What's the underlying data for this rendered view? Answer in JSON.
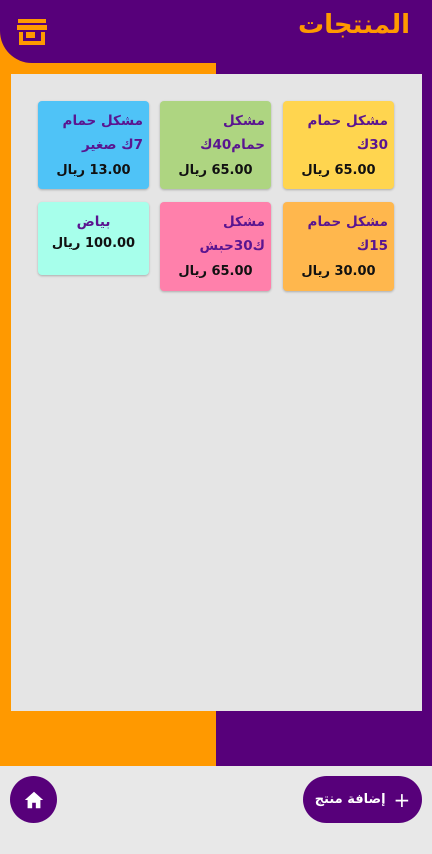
{
  "header": {
    "title": "المنتجات",
    "store_icon": "store-icon"
  },
  "colors": {
    "purple": "#57007a",
    "orange": "#ff9900",
    "panel": "#e5e5e5"
  },
  "products": [
    {
      "name": "مشكل حمام 30ك",
      "price": "65.00 ريال",
      "color": "#ffd54f"
    },
    {
      "name": "مشكل حمام40ك",
      "price": "65.00 ريال",
      "color": "#aed581"
    },
    {
      "name": "مشكل حمام 7ك صغير",
      "price": "13.00 ريال",
      "color": "#4fc3f7"
    },
    {
      "name": "مشكل حمام 15ك",
      "price": "30.00 ريال",
      "color": "#ffb74d"
    },
    {
      "name": "مشكل ك30حبش",
      "price": "65.00 ريال",
      "color": "#ff80ab"
    },
    {
      "name": "بياض",
      "price": "100.00 ريال",
      "color": "#a7ffeb"
    }
  ],
  "footer": {
    "add_label": "إضافة منتج",
    "add_icon": "plus-icon",
    "home_icon": "home-icon"
  }
}
